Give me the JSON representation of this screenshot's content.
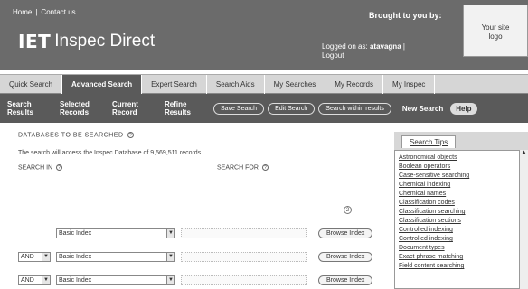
{
  "header": {
    "links": [
      "Home",
      "|",
      "Contact us"
    ],
    "logo_iet": "IET",
    "logo_product": "Inspec Direct",
    "brought_by": "Brought to you by:",
    "logged_on_label": "Logged on as:",
    "username": "atavagna",
    "separator": "|",
    "logout": "Logout",
    "site_logo": [
      "Your site",
      "logo"
    ]
  },
  "tabs": [
    {
      "label": "Quick Search",
      "active": false
    },
    {
      "label": "Advanced Search",
      "active": true
    },
    {
      "label": "Expert Search",
      "active": false
    },
    {
      "label": "Search Aids",
      "active": false
    },
    {
      "label": "My Searches",
      "active": false
    },
    {
      "label": "My Records",
      "active": false
    },
    {
      "label": "My Inspec",
      "active": false
    }
  ],
  "subbar": {
    "items": [
      "Search Results",
      "Selected Records",
      "Current Record",
      "Refine Results"
    ],
    "pills": [
      "Save Search",
      "Edit Search",
      "Search within results"
    ],
    "new_search": "New Search",
    "help": "Help"
  },
  "main": {
    "db_heading": "DATABASES TO BE SEARCHED",
    "db_text": "The search will access the Inspec Database of 9,569,511 records",
    "search_in": "SEARCH IN",
    "search_for": "SEARCH FOR",
    "step_number": "2",
    "rows": [
      {
        "op": "",
        "index": "Basic Index",
        "browse": "Browse Index"
      },
      {
        "op": "AND",
        "index": "Basic Index",
        "browse": "Browse Index"
      },
      {
        "op": "AND",
        "index": "Basic Index",
        "browse": "Browse Index"
      }
    ]
  },
  "sidebar": {
    "tab": "Search Tips",
    "items": [
      "Astronomical objects",
      "Boolean operators",
      "Case-sensitive searching",
      "Chemical indexing",
      "Chemical names",
      "Classification codes",
      "Classification searching",
      "Classification sections",
      "Controlled indexing",
      "Controlled indexing",
      "Document types",
      "Exact phrase matching",
      "Field content searching"
    ]
  }
}
